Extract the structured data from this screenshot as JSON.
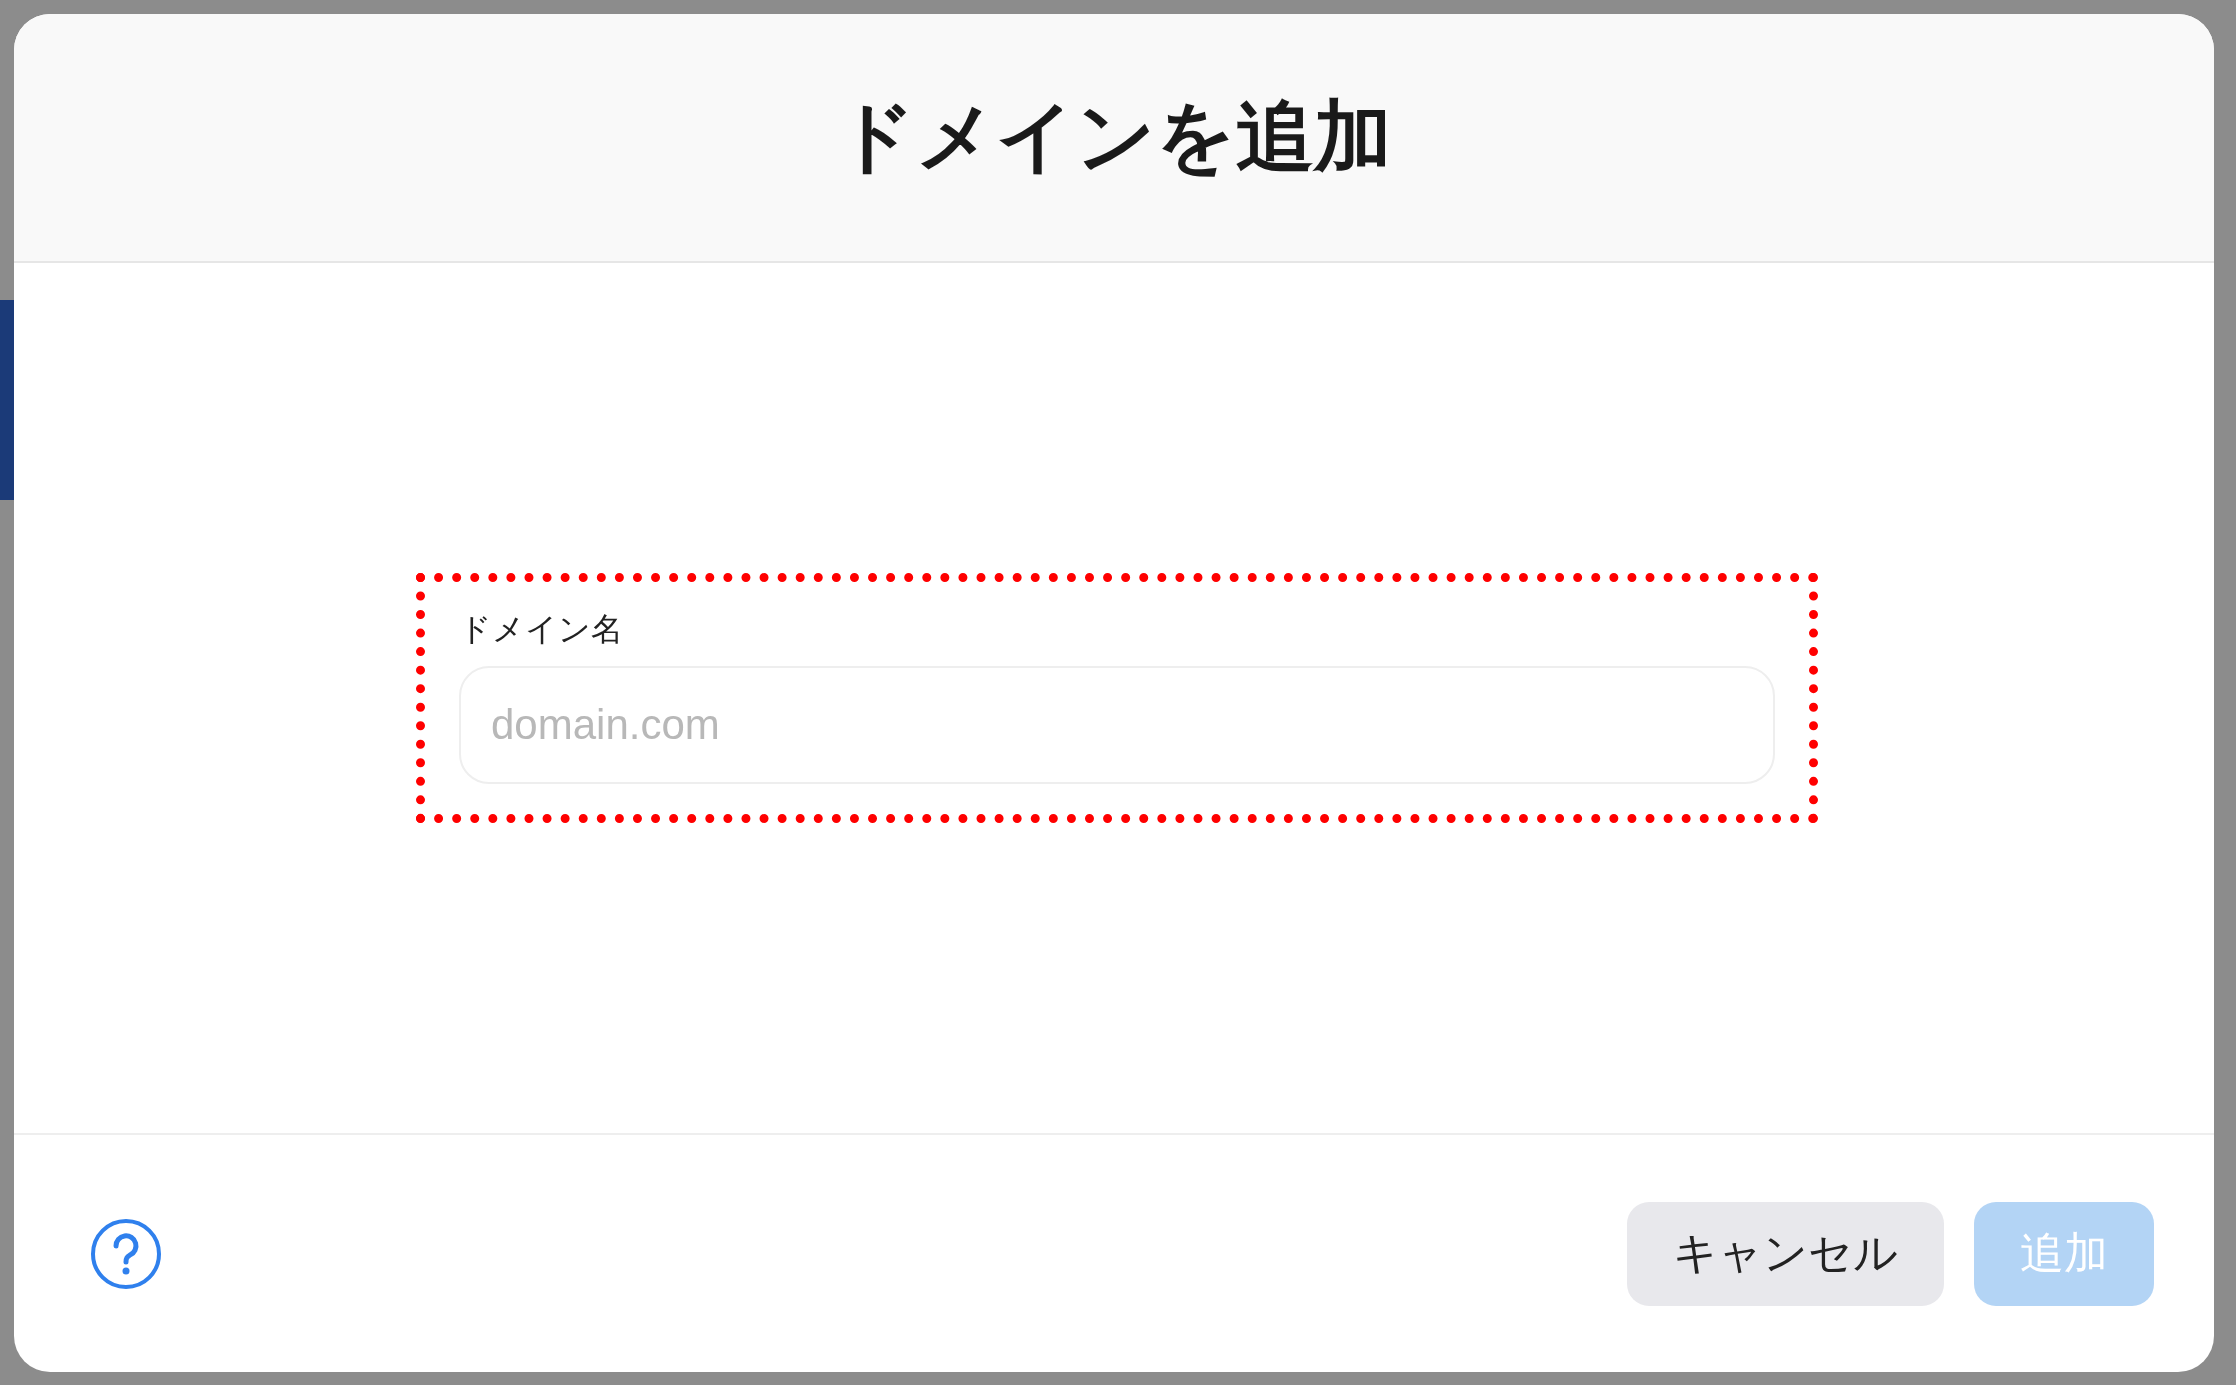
{
  "dialog": {
    "title": "ドメインを追加"
  },
  "domain_field": {
    "label": "ドメイン名",
    "placeholder": "domain.com",
    "highlighted": true
  },
  "buttons": [
    {
      "label": "キャンセル",
      "kind": "secondary",
      "disabled": false
    },
    {
      "label": "追加",
      "kind": "primary",
      "disabled": true
    }
  ]
}
